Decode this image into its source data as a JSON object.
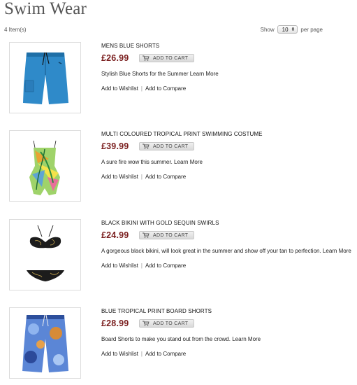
{
  "page": {
    "title": "Swim Wear"
  },
  "toolbar": {
    "item_count": "4 Item(s)",
    "show_label": "Show",
    "per_page_value": "10",
    "per_page_suffix": "per page"
  },
  "products": [
    {
      "name": "MENS BLUE SHORTS",
      "price": "£26.99",
      "cart_label": "ADD TO CART",
      "description": "Stylish Blue Shorts for the Summer",
      "learn_more": "Learn More",
      "wishlist": "Add to Wishlist",
      "compare": "Add to Compare"
    },
    {
      "name": "MULTI COLOURED TROPICAL PRINT SWIMMING COSTUME",
      "price": "£39.99",
      "cart_label": "ADD TO CART",
      "description": "A sure fire wow this summer.",
      "learn_more": "Learn More",
      "wishlist": "Add to Wishlist",
      "compare": "Add to Compare"
    },
    {
      "name": "BLACK BIKINI WITH GOLD SEQUIN SWIRLS",
      "price": "£24.99",
      "cart_label": "ADD TO CART",
      "description": "A gorgeous black bikini, will look great in the summer and show off your tan to perfection.",
      "learn_more": "Learn More",
      "wishlist": "Add to Wishlist",
      "compare": "Add to Compare"
    },
    {
      "name": "BLUE TROPICAL PRINT BOARD SHORTS",
      "price": "£28.99",
      "cart_label": "ADD TO CART",
      "description": "Board Shorts to make you stand out from the crowd.",
      "learn_more": "Learn More",
      "wishlist": "Add to Wishlist",
      "compare": "Add to Compare"
    }
  ],
  "icons": {
    "cart": "shopping-cart-icon",
    "select": "updown-arrows-icon"
  },
  "colors": {
    "price": "#7a1e1e",
    "title": "#555555"
  }
}
